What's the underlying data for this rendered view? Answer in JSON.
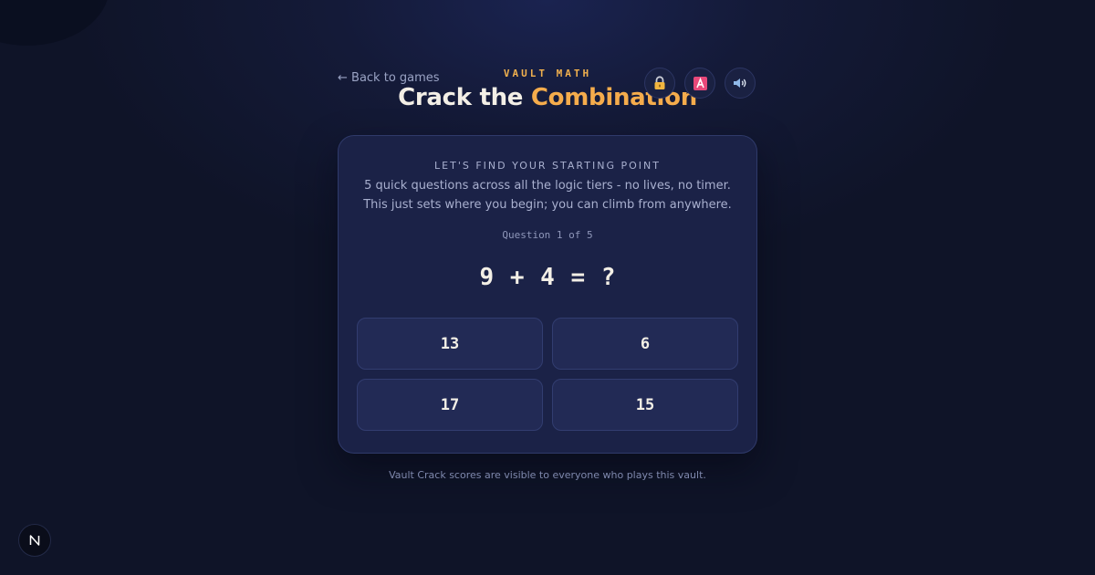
{
  "header": {
    "back_label": "← Back to games",
    "kicker": "VAULT MATH",
    "title_prefix": "Crack the ",
    "title_accent": "Combination"
  },
  "toolbar": {
    "lock_icon": "lock-icon",
    "font_icon": "font-size-icon",
    "sound_icon": "speaker-icon"
  },
  "card": {
    "heading": "LET'S FIND YOUR STARTING POINT",
    "subtitle_line1": "5 quick questions across all the logic tiers - no lives, no timer.",
    "subtitle_line2": "This just sets where you begin; you can climb from anywhere.",
    "progress": "Question 1 of 5",
    "equation": "9 + 4 = ?",
    "answers": [
      "13",
      "6",
      "17",
      "15"
    ]
  },
  "footer": {
    "note": "Vault Crack scores are visible to everyone who plays this vault.",
    "badge_icon": "next-logo-icon"
  },
  "colors": {
    "accent": "#f5ac4c",
    "background": "#141a38",
    "card": "#1b2247",
    "answer_tile": "#222a55"
  }
}
